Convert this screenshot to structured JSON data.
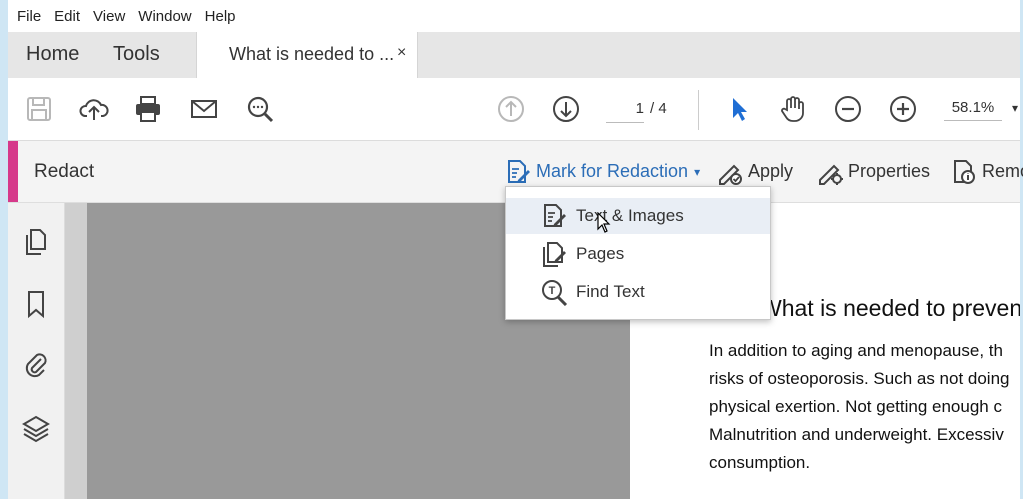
{
  "menu": [
    "File",
    "Edit",
    "View",
    "Window",
    "Help"
  ],
  "tabs": {
    "home": "Home",
    "tools": "Tools",
    "document_title": "What is needed to ...",
    "close": "×"
  },
  "toolbar": {
    "icons": [
      "save-icon",
      "upload-cloud-icon",
      "print-icon",
      "email-icon",
      "search-zoom-icon",
      "page-up-icon",
      "page-down-icon",
      "select-arrow-icon",
      "hand-icon",
      "zoom-out-icon",
      "zoom-in-icon"
    ],
    "page_current": "1",
    "page_total": "/ 4",
    "zoom": "58.1%",
    "zoom_caret": "▾"
  },
  "redact_bar": {
    "title": "Redact",
    "mark_for_redaction": "Mark for Redaction",
    "mark_caret": "▾",
    "apply": "Apply",
    "properties": "Properties",
    "remove": "Remo"
  },
  "dropdown": {
    "items": [
      {
        "label": "Text & Images",
        "icon": "text-images-icon"
      },
      {
        "label": "Pages",
        "icon": "pages-icon"
      },
      {
        "label": "Find Text",
        "icon": "find-text-icon"
      }
    ]
  },
  "side_panel": {
    "icons": [
      "page-thumbnails-icon",
      "bookmark-icon",
      "attachment-icon",
      "layers-icon"
    ]
  },
  "document": {
    "heading": "What is needed to preven",
    "lines": [
      "In addition to aging and menopause, th",
      "risks of osteoporosis. Such as not doing",
      "physical exertion. Not getting enough c",
      "Malnutrition and underweight. Excessiv",
      "consumption."
    ]
  },
  "colors": {
    "accent_magenta": "#d6398a",
    "link_blue": "#2b6db7",
    "frame_blue": "#cfe6f4"
  }
}
